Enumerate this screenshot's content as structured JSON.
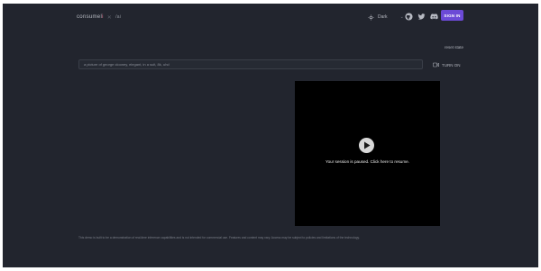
{
  "header": {
    "brand_name_prefix": "consumel",
    "brand_name_suffix": "i",
    "brand_sep": "✕",
    "brand_sub": "/ai",
    "theme_label": "Dark",
    "signin_label": "SIGN IN"
  },
  "icons": {
    "theme": "sun-icon",
    "github": "github-icon",
    "twitter": "twitter-icon",
    "discord": "discord-icon",
    "camera": "camera-icon",
    "play": "play-icon"
  },
  "reset_link": "reset state",
  "prompt": {
    "value": "a picture of george clooney, elegant, in a suit, 8k, uhd"
  },
  "camera_toggle": {
    "label": "TURN ON"
  },
  "video": {
    "paused_message": "Your session is paused. Click here to resume."
  },
  "disclaimer": "This demo is built to be a demonstration of real-time inference capabilities and is not intended for commercial use. Features and content may vary. Access may be subject to policies and limitations of the technology.",
  "colors": {
    "background": "#22252e",
    "accent_button": "#6c4ad6",
    "brand_accent": "#e8728e",
    "video_background": "#000000"
  }
}
